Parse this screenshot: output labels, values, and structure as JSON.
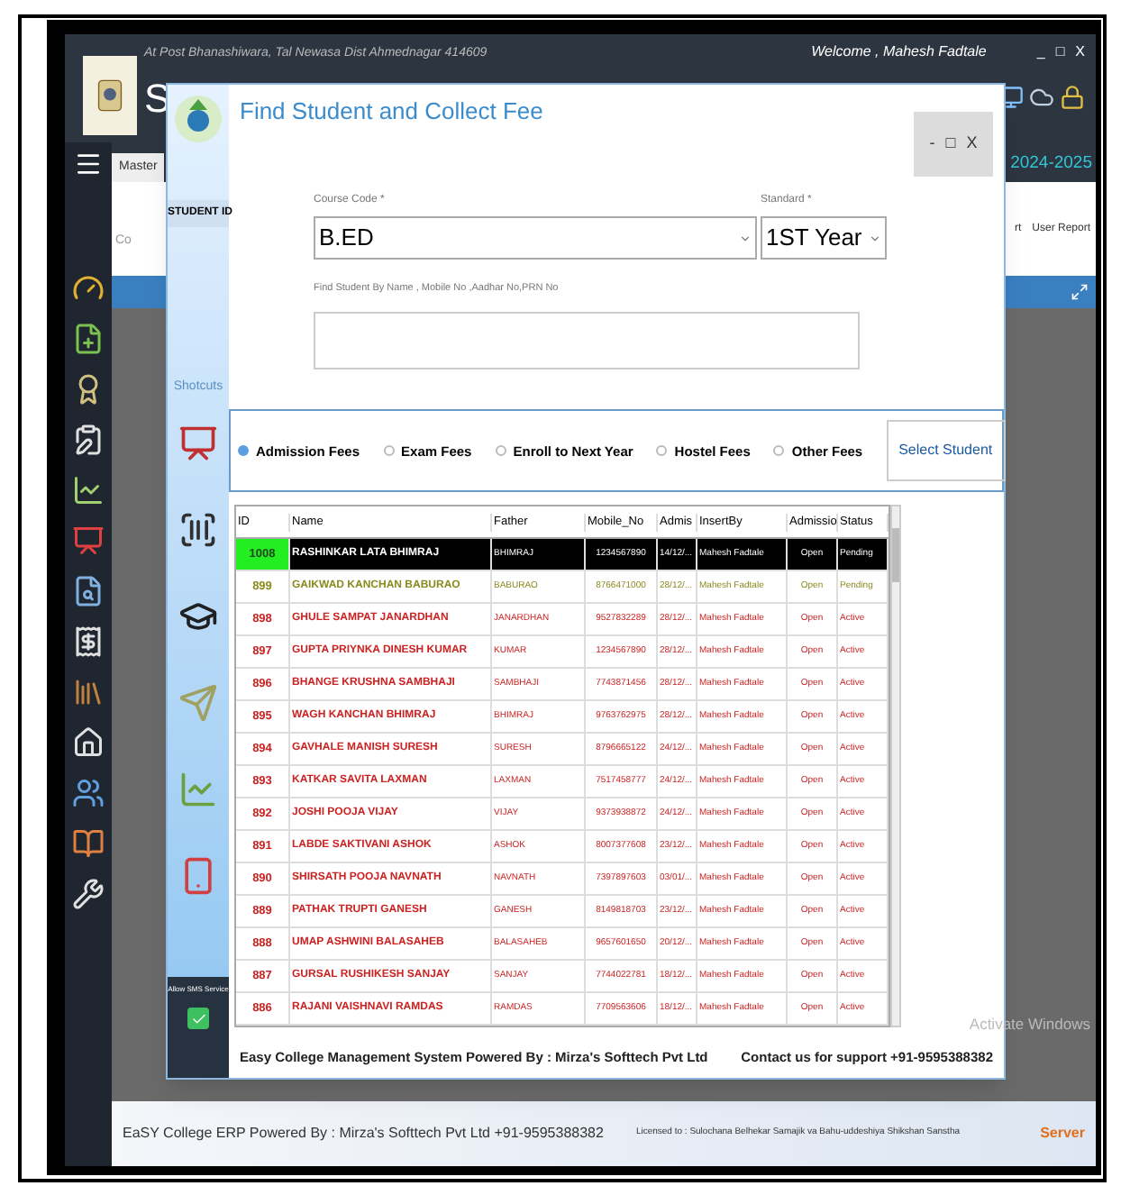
{
  "app": {
    "address": "At Post Bhanashiwara, Tal Newasa Dist Ahmednagar 414609",
    "welcome": "Welcome , Mahesh Fadtale",
    "window_controls": [
      "_",
      "□",
      "X"
    ],
    "title_fragment": "S",
    "menu_tab": "Master",
    "session": "2024-2025",
    "ribbon_fragment": "Co",
    "ribbon_labels": [
      "rt",
      "User Report"
    ]
  },
  "dialog": {
    "title": "Find Student and Collect Fee",
    "window_controls": [
      "-",
      "□",
      "X"
    ],
    "sidebar": {
      "student_id_label": "STUDENT ID",
      "shortcuts_label": "Shotcuts",
      "sms": {
        "label": "Allow SMS Service",
        "checked": true
      }
    },
    "course_code": {
      "label": "Course Code *",
      "value": "B.ED"
    },
    "standard": {
      "label": "Standard *",
      "value": "1ST Year"
    },
    "search": {
      "label": "Find Student By Name , Mobile No ,Aadhar No,PRN No"
    },
    "fee_types": [
      {
        "label": "Admission Fees",
        "selected": true
      },
      {
        "label": "Exam Fees",
        "selected": false
      },
      {
        "label": "Enroll to Next Year",
        "selected": false
      },
      {
        "label": "Hostel Fees",
        "selected": false
      },
      {
        "label": "Other Fees",
        "selected": false
      }
    ],
    "select_button": "Select Student",
    "table": {
      "columns": [
        "ID",
        "Name",
        "Father",
        "Mobile_No",
        "Admis",
        "InsertBy",
        "Admissio",
        "Status"
      ],
      "rows": [
        {
          "cells": [
            "1008",
            "RASHINKAR LATA BHIMRAJ",
            "BHIMRAJ",
            "1234567890",
            "14/12/...",
            "Mahesh Fadtale",
            "Open",
            "Pending"
          ],
          "selected": true
        },
        {
          "cells": [
            "899",
            "GAIKWAD KANCHAN BABURAO",
            "BABURAO",
            "8766471000",
            "28/12/...",
            "Mahesh Fadtale",
            "Open",
            "Pending"
          ],
          "selected": false,
          "color": "#8a8a1e"
        },
        {
          "cells": [
            "898",
            "GHULE SAMPAT JANARDHAN",
            "JANARDHAN",
            "9527832289",
            "28/12/...",
            "Mahesh Fadtale",
            "Open",
            "Active"
          ],
          "selected": false,
          "color": "#cc2222"
        },
        {
          "cells": [
            "897",
            "GUPTA PRIYNKA DINESH KUMAR",
            "KUMAR",
            "1234567890",
            "28/12/...",
            "Mahesh Fadtale",
            "Open",
            "Active"
          ],
          "selected": false,
          "color": "#cc2222"
        },
        {
          "cells": [
            "896",
            "BHANGE KRUSHNA SAMBHAJI",
            "SAMBHAJI",
            "7743871456",
            "28/12/...",
            "Mahesh Fadtale",
            "Open",
            "Active"
          ],
          "selected": false,
          "color": "#cc2222"
        },
        {
          "cells": [
            "895",
            "WAGH KANCHAN BHIMRAJ",
            "BHIMRAJ",
            "9763762975",
            "28/12/...",
            "Mahesh Fadtale",
            "Open",
            "Active"
          ],
          "selected": false,
          "color": "#cc2222"
        },
        {
          "cells": [
            "894",
            "GAVHALE MANISH SURESH",
            "SURESH",
            "8796665122",
            "24/12/...",
            "Mahesh Fadtale",
            "Open",
            "Active"
          ],
          "selected": false,
          "color": "#cc2222"
        },
        {
          "cells": [
            "893",
            "KATKAR SAVITA LAXMAN",
            "LAXMAN",
            "7517458777",
            "24/12/...",
            "Mahesh Fadtale",
            "Open",
            "Active"
          ],
          "selected": false,
          "color": "#cc2222"
        },
        {
          "cells": [
            "892",
            "JOSHI POOJA VIJAY",
            "VIJAY",
            "9373938872",
            "24/12/...",
            "Mahesh Fadtale",
            "Open",
            "Active"
          ],
          "selected": false,
          "color": "#cc2222"
        },
        {
          "cells": [
            "891",
            "LABDE SAKTIVANI ASHOK",
            "ASHOK",
            "8007377608",
            "23/12/...",
            "Mahesh Fadtale",
            "Open",
            "Active"
          ],
          "selected": false,
          "color": "#cc2222"
        },
        {
          "cells": [
            "890",
            "SHIRSATH POOJA NAVNATH",
            "NAVNATH",
            "7397897603",
            "03/01/...",
            "Mahesh Fadtale",
            "Open",
            "Active"
          ],
          "selected": false,
          "color": "#cc2222"
        },
        {
          "cells": [
            "889",
            "PATHAK TRUPTI GANESH",
            "GANESH",
            "8149818703",
            "23/12/...",
            "Mahesh Fadtale",
            "Open",
            "Active"
          ],
          "selected": false,
          "color": "#cc2222"
        },
        {
          "cells": [
            "888",
            "UMAP ASHWINI BALASAHEB",
            "BALASAHEB",
            "9657601650",
            "20/12/...",
            "Mahesh Fadtale",
            "Open",
            "Active"
          ],
          "selected": false,
          "color": "#cc2222"
        },
        {
          "cells": [
            "887",
            "GURSAL RUSHIKESH SANJAY",
            "SANJAY",
            "7744022781",
            "18/12/...",
            "Mahesh Fadtale",
            "Open",
            "Active"
          ],
          "selected": false,
          "color": "#cc2222"
        },
        {
          "cells": [
            "886",
            "RAJANI VAISHNAVI RAMDAS",
            "RAMDAS",
            "7709563606",
            "18/12/...",
            "Mahesh Fadtale",
            "Open",
            "Active"
          ],
          "selected": false,
          "color": "#cc2222"
        }
      ]
    },
    "overlay_notice": "Activate Windows",
    "footer": {
      "left": "Easy College Management System Powered By : Mirza's Softtech Pvt Ltd",
      "right": "Contact us for support +91-9595388382"
    }
  },
  "status_bar": {
    "left": "EaSY College ERP Powered By : Mirza's Softtech Pvt Ltd +91-9595388382",
    "license": "Licensed to : Sulochana Belhekar Samajik va Bahu-uddeshiya Shikshan Sanstha",
    "server": "Server"
  }
}
